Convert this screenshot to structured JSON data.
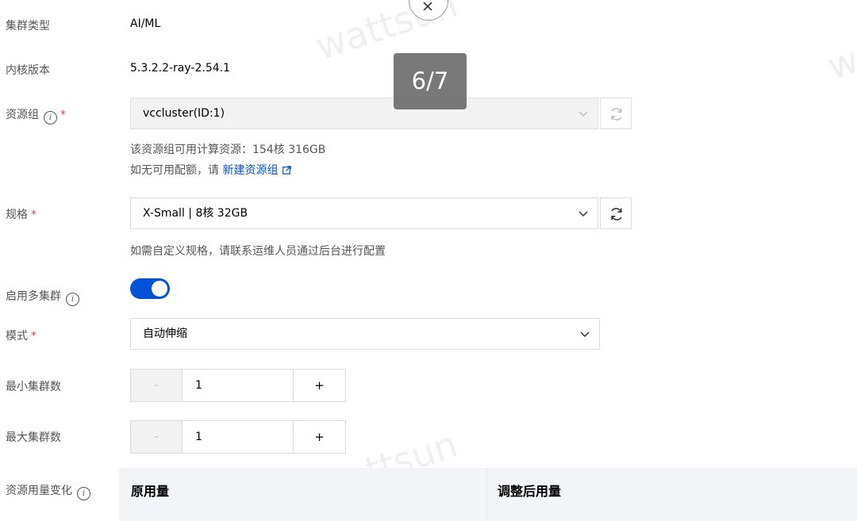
{
  "form": {
    "cluster_type": {
      "label": "集群类型",
      "value": "AI/ML"
    },
    "kernel_version": {
      "label": "内核版本",
      "value": "5.3.2.2-ray-2.54.1"
    },
    "resource_group": {
      "label": "资源组",
      "required_mark": "*",
      "selected": "vccluster(ID:1)",
      "available_text": "该资源组可用计算资源：154核 316GB",
      "no_quota_prefix": "如无可用配额，请",
      "create_link": "新建资源组"
    },
    "spec": {
      "label": "规格",
      "required_mark": "*",
      "selected": "X-Small | 8核 32GB",
      "help": "如需自定义规格，请联系运维人员通过后台进行配置"
    },
    "multi_cluster": {
      "label": "启用多集群",
      "enabled": true
    },
    "mode": {
      "label": "模式",
      "required_mark": "*",
      "selected": "自动伸缩"
    },
    "min_clusters": {
      "label": "最小集群数",
      "value": "1",
      "minus": "-",
      "plus": "+"
    },
    "max_clusters": {
      "label": "最大集群数",
      "value": "1",
      "minus": "-",
      "plus": "+"
    },
    "usage_change": {
      "label": "资源用量变化",
      "columns": [
        "原用量",
        "调整后用量"
      ]
    }
  },
  "overlay": {
    "page_indicator": "6/7",
    "watermark": "wattsun"
  },
  "icons": {
    "info": "info-icon",
    "chevron": "chevron-down-icon",
    "refresh": "refresh-icon",
    "external": "external-link-icon",
    "close": "close-icon"
  },
  "colors": {
    "primary": "#0052d9",
    "required": "#e54545",
    "label": "#555555"
  }
}
